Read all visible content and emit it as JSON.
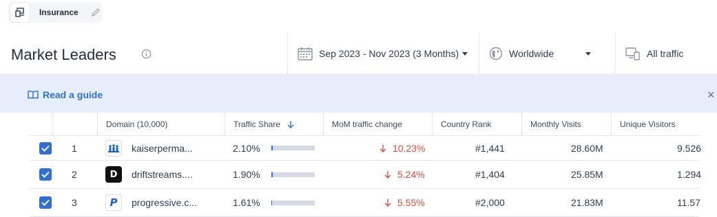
{
  "topbar": {
    "chip_label": "Insurance"
  },
  "header": {
    "title": "Market Leaders",
    "date_filter": "Sep 2023 - Nov 2023 (3 Months)",
    "geo_filter": "Worldwide",
    "traffic_filter": "All traffic"
  },
  "guide": {
    "text": "Read a guide",
    "close": "×"
  },
  "table": {
    "columns": [
      "Domain (10,000)",
      "Traffic Share",
      "MoM traffic change",
      "Country Rank",
      "Monthly Visits",
      "Unique Visitors"
    ],
    "rows": [
      {
        "rank": "1",
        "domain": "kaiserperma...",
        "share": "2.10%",
        "share_fraction": 0.033,
        "change": "10.23%",
        "country_rank": "#1,441",
        "visits": "28.60M",
        "unique": "9.526"
      },
      {
        "rank": "2",
        "domain": "driftstreams....",
        "share": "1.90%",
        "share_fraction": 0.03,
        "change": "5.24%",
        "country_rank": "#1,404",
        "visits": "25.85M",
        "unique": "1.294"
      },
      {
        "rank": "3",
        "domain": "progressive.c...",
        "share": "1.61%",
        "share_fraction": 0.025,
        "change": "5.55%",
        "country_rank": "#2,000",
        "visits": "21.83M",
        "unique": "11.57"
      }
    ]
  },
  "colors": {
    "accent": "#2f6fd6",
    "negative": "#e0483b",
    "guide_bg": "#e6edfb"
  }
}
